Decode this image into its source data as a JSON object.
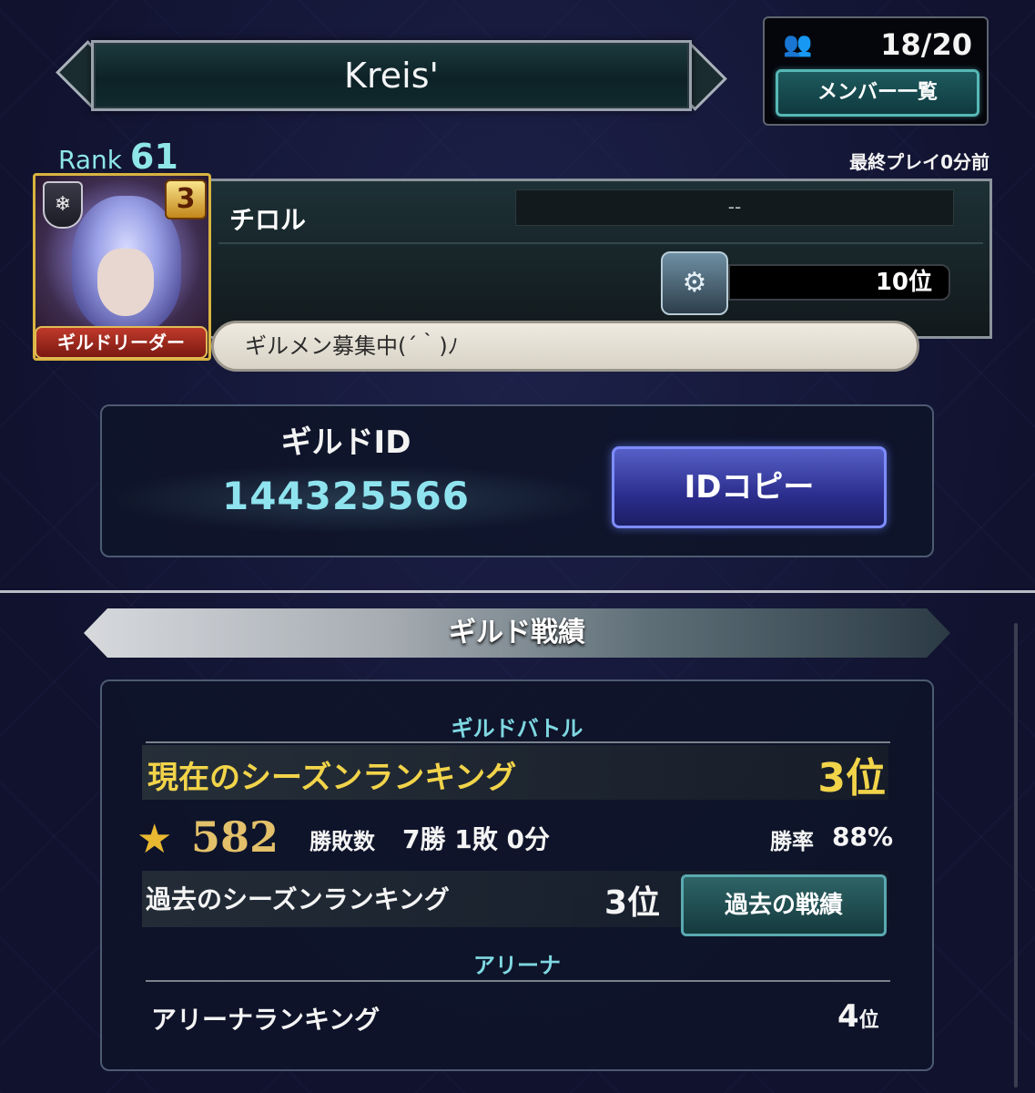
{
  "guild": {
    "name": "Kreis'"
  },
  "members": {
    "icon": "group-icon",
    "count": "18/20",
    "list_button": "メンバー一覧"
  },
  "last_play": "最終プレイ0分前",
  "leader": {
    "rank_label": "Rank",
    "rank_value": "61",
    "star_level": "3",
    "role_badge": "ギルドリーダー",
    "name": "チロル",
    "title": "--",
    "ranking": "10位",
    "emblem_icon": "rank-emblem-icon"
  },
  "message": "ギルメン募集中(´｀)ﾉ",
  "guild_id": {
    "label": "ギルドID",
    "value": "144325566",
    "copy_button": "IDコピー"
  },
  "records": {
    "section_title": "ギルド戦績",
    "battle": {
      "heading": "ギルドバトル",
      "current_label": "現在のシーズンランキング",
      "current_rank": "3位",
      "points": "582",
      "wl_label": "勝敗数",
      "wl_value": "7勝 1敗 0分",
      "win_rate_label": "勝率",
      "win_rate_value": "88%",
      "past_label": "過去のシーズンランキング",
      "past_rank": "3位",
      "past_button": "過去の戦績"
    },
    "arena": {
      "heading": "アリーナ",
      "ranking_label": "アリーナランキング",
      "ranking_value": "4",
      "ranking_suffix": "位"
    }
  }
}
